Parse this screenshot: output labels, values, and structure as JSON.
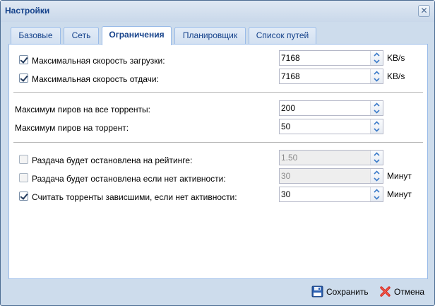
{
  "window": {
    "title": "Настройки",
    "close_glyph": "✕"
  },
  "tabs": [
    {
      "label": "Базовые",
      "active": false
    },
    {
      "label": "Сеть",
      "active": false
    },
    {
      "label": "Ограничения",
      "active": true
    },
    {
      "label": "Планировщик",
      "active": false
    },
    {
      "label": "Список путей",
      "active": false
    }
  ],
  "limits": {
    "download": {
      "label": "Максимальная скорость загрузки:",
      "checked": true,
      "value": "7168",
      "unit": "KB/s"
    },
    "upload": {
      "label": "Максимальная скорость отдачи:",
      "checked": true,
      "value": "7168",
      "unit": "KB/s"
    },
    "peers_total": {
      "label": "Максимум пиров на все торренты:",
      "value": "200"
    },
    "peers_per_torrent": {
      "label": "Максимум пиров на торрент:",
      "value": "50"
    },
    "seed_ratio": {
      "label": "Раздача будет остановлена на рейтинге:",
      "checked": false,
      "value": "1.50",
      "disabled": true
    },
    "seed_idle": {
      "label": "Раздача будет остановлена если нет активности:",
      "checked": false,
      "value": "30",
      "unit": "Минут",
      "disabled": true
    },
    "stalled": {
      "label": "Считать торренты зависшими, если нет активности:",
      "checked": true,
      "value": "30",
      "unit": "Минут"
    }
  },
  "footer": {
    "save_label": "Сохранить",
    "cancel_label": "Отмена",
    "save_icon": "floppy-disk-icon",
    "cancel_icon": "red-x-icon"
  },
  "colors": {
    "title_text": "#15428b",
    "tab_border": "#99bbe8",
    "window_bg": "#cddcec",
    "cancel_red": "#d9261c",
    "save_blue": "#2d62b3"
  }
}
